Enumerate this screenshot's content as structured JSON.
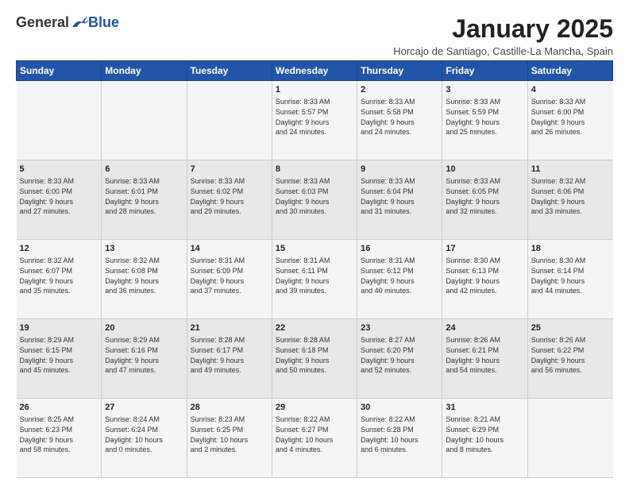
{
  "logo": {
    "general": "General",
    "blue": "Blue"
  },
  "title": "January 2025",
  "subtitle": "Horcajo de Santiago, Castille-La Mancha, Spain",
  "weekdays": [
    "Sunday",
    "Monday",
    "Tuesday",
    "Wednesday",
    "Thursday",
    "Friday",
    "Saturday"
  ],
  "weeks": [
    [
      {
        "day": "",
        "info": ""
      },
      {
        "day": "",
        "info": ""
      },
      {
        "day": "",
        "info": ""
      },
      {
        "day": "1",
        "info": "Sunrise: 8:33 AM\nSunset: 5:57 PM\nDaylight: 9 hours\nand 24 minutes."
      },
      {
        "day": "2",
        "info": "Sunrise: 8:33 AM\nSunset: 5:58 PM\nDaylight: 9 hours\nand 24 minutes."
      },
      {
        "day": "3",
        "info": "Sunrise: 8:33 AM\nSunset: 5:59 PM\nDaylight: 9 hours\nand 25 minutes."
      },
      {
        "day": "4",
        "info": "Sunrise: 8:33 AM\nSunset: 6:00 PM\nDaylight: 9 hours\nand 26 minutes."
      }
    ],
    [
      {
        "day": "5",
        "info": "Sunrise: 8:33 AM\nSunset: 6:00 PM\nDaylight: 9 hours\nand 27 minutes."
      },
      {
        "day": "6",
        "info": "Sunrise: 8:33 AM\nSunset: 6:01 PM\nDaylight: 9 hours\nand 28 minutes."
      },
      {
        "day": "7",
        "info": "Sunrise: 8:33 AM\nSunset: 6:02 PM\nDaylight: 9 hours\nand 29 minutes."
      },
      {
        "day": "8",
        "info": "Sunrise: 8:33 AM\nSunset: 6:03 PM\nDaylight: 9 hours\nand 30 minutes."
      },
      {
        "day": "9",
        "info": "Sunrise: 8:33 AM\nSunset: 6:04 PM\nDaylight: 9 hours\nand 31 minutes."
      },
      {
        "day": "10",
        "info": "Sunrise: 8:33 AM\nSunset: 6:05 PM\nDaylight: 9 hours\nand 32 minutes."
      },
      {
        "day": "11",
        "info": "Sunrise: 8:32 AM\nSunset: 6:06 PM\nDaylight: 9 hours\nand 33 minutes."
      }
    ],
    [
      {
        "day": "12",
        "info": "Sunrise: 8:32 AM\nSunset: 6:07 PM\nDaylight: 9 hours\nand 35 minutes."
      },
      {
        "day": "13",
        "info": "Sunrise: 8:32 AM\nSunset: 6:08 PM\nDaylight: 9 hours\nand 36 minutes."
      },
      {
        "day": "14",
        "info": "Sunrise: 8:31 AM\nSunset: 6:09 PM\nDaylight: 9 hours\nand 37 minutes."
      },
      {
        "day": "15",
        "info": "Sunrise: 8:31 AM\nSunset: 6:11 PM\nDaylight: 9 hours\nand 39 minutes."
      },
      {
        "day": "16",
        "info": "Sunrise: 8:31 AM\nSunset: 6:12 PM\nDaylight: 9 hours\nand 40 minutes."
      },
      {
        "day": "17",
        "info": "Sunrise: 8:30 AM\nSunset: 6:13 PM\nDaylight: 9 hours\nand 42 minutes."
      },
      {
        "day": "18",
        "info": "Sunrise: 8:30 AM\nSunset: 6:14 PM\nDaylight: 9 hours\nand 44 minutes."
      }
    ],
    [
      {
        "day": "19",
        "info": "Sunrise: 8:29 AM\nSunset: 6:15 PM\nDaylight: 9 hours\nand 45 minutes."
      },
      {
        "day": "20",
        "info": "Sunrise: 8:29 AM\nSunset: 6:16 PM\nDaylight: 9 hours\nand 47 minutes."
      },
      {
        "day": "21",
        "info": "Sunrise: 8:28 AM\nSunset: 6:17 PM\nDaylight: 9 hours\nand 49 minutes."
      },
      {
        "day": "22",
        "info": "Sunrise: 8:28 AM\nSunset: 6:18 PM\nDaylight: 9 hours\nand 50 minutes."
      },
      {
        "day": "23",
        "info": "Sunrise: 8:27 AM\nSunset: 6:20 PM\nDaylight: 9 hours\nand 52 minutes."
      },
      {
        "day": "24",
        "info": "Sunrise: 8:26 AM\nSunset: 6:21 PM\nDaylight: 9 hours\nand 54 minutes."
      },
      {
        "day": "25",
        "info": "Sunrise: 8:26 AM\nSunset: 6:22 PM\nDaylight: 9 hours\nand 56 minutes."
      }
    ],
    [
      {
        "day": "26",
        "info": "Sunrise: 8:25 AM\nSunset: 6:23 PM\nDaylight: 9 hours\nand 58 minutes."
      },
      {
        "day": "27",
        "info": "Sunrise: 8:24 AM\nSunset: 6:24 PM\nDaylight: 10 hours\nand 0 minutes."
      },
      {
        "day": "28",
        "info": "Sunrise: 8:23 AM\nSunset: 6:25 PM\nDaylight: 10 hours\nand 2 minutes."
      },
      {
        "day": "29",
        "info": "Sunrise: 8:22 AM\nSunset: 6:27 PM\nDaylight: 10 hours\nand 4 minutes."
      },
      {
        "day": "30",
        "info": "Sunrise: 8:22 AM\nSunset: 6:28 PM\nDaylight: 10 hours\nand 6 minutes."
      },
      {
        "day": "31",
        "info": "Sunrise: 8:21 AM\nSunset: 6:29 PM\nDaylight: 10 hours\nand 8 minutes."
      },
      {
        "day": "",
        "info": ""
      }
    ]
  ]
}
